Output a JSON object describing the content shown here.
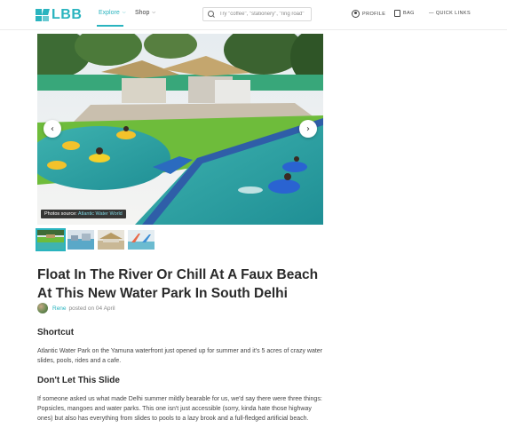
{
  "header": {
    "logo": "LBB",
    "nav": {
      "explore": "Explore",
      "shop": "Shop"
    },
    "search": {
      "placeholder": "Try \"coffee\", \"stationery\", \"ring road\""
    },
    "profile": "PROFILE",
    "bag": "BAG",
    "quick_links": "— QUICK LINKS"
  },
  "hero": {
    "photo_source_label": "Photos source:",
    "photo_source_name": "Atlantic Water World",
    "prev_icon": "chevron-left-icon",
    "next_icon": "chevron-right-icon"
  },
  "thumbnails": [
    "water-park-1",
    "water-park-2",
    "water-park-3",
    "water-park-4"
  ],
  "article": {
    "title": "Float In The River Or Chill At A Faux Beach At This New Water Park In South Delhi",
    "author": "Rene",
    "posted": "posted on 04 April",
    "sections": [
      {
        "heading": "Shortcut",
        "body": "Atlantic Water Park on the Yamuna waterfront just opened up for summer and it's 5 acres of crazy water slides, pools, rides and a cafe."
      },
      {
        "heading": "Don't Let This Slide",
        "body": "If someone asked us what made Delhi summer mildly bearable for us, we'd say there were three things: Popsicles, mangoes and water parks. This one isn't just accessible (sorry, kinda hate those highway ones) but also has everything from slides to pools to a lazy brook and a full-fledged artificial beach."
      }
    ]
  },
  "colors": {
    "accent": "#2ab4bf",
    "text": "#2b2b2b"
  }
}
